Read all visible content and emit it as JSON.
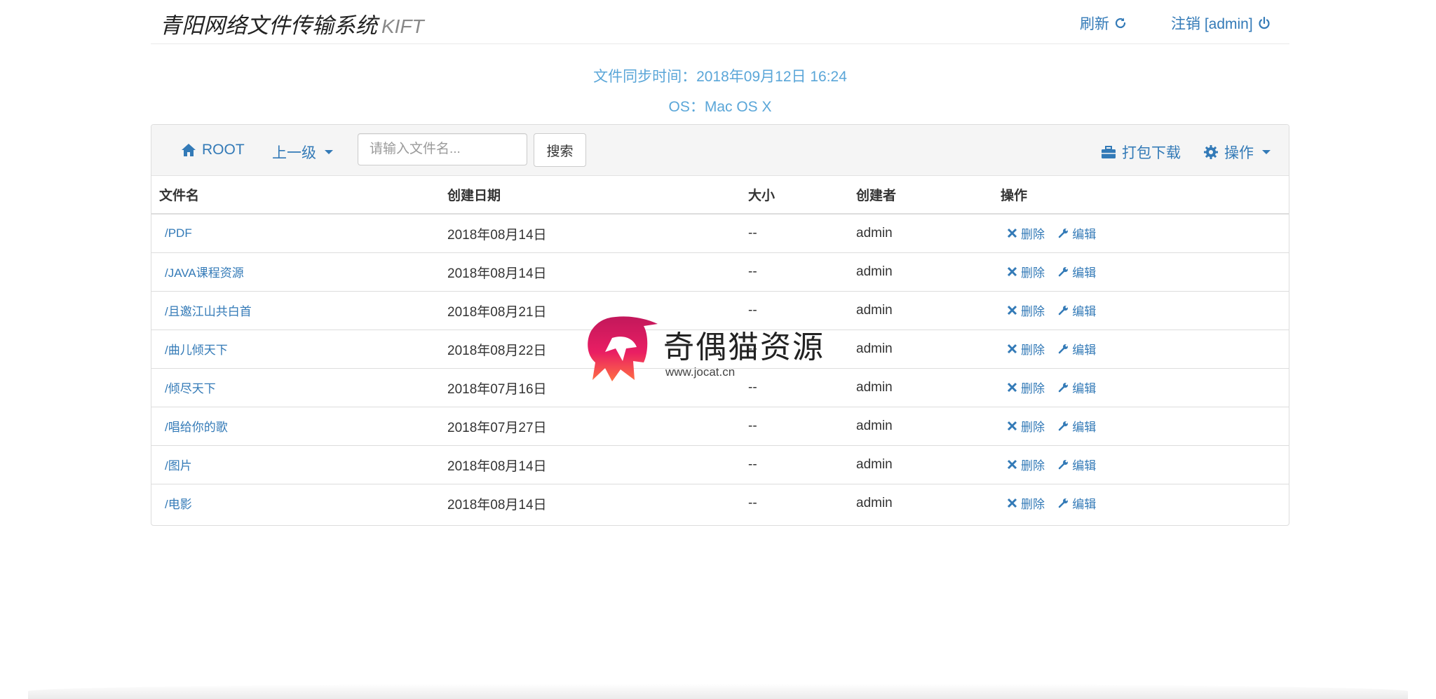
{
  "header": {
    "title": "青阳网络文件传输系统",
    "subtitle": "KIFT",
    "refresh_label": "刷新",
    "logout_label": "注销 [admin]"
  },
  "info": {
    "sync_time": "文件同步时间：2018年09月12日 16:24",
    "os": "OS：Mac OS X"
  },
  "toolbar": {
    "root_label": "ROOT",
    "parent_label": "上一级",
    "search_placeholder": "请输入文件名...",
    "search_button": "搜索",
    "pack_download_label": "打包下载",
    "operations_label": "操作"
  },
  "table": {
    "headers": [
      "文件名",
      "创建日期",
      "大小",
      "创建者",
      "操作"
    ],
    "delete_label": "删除",
    "edit_label": "编辑",
    "rows": [
      {
        "name": "/PDF",
        "date": "2018年08月14日",
        "size": "--",
        "creator": "admin"
      },
      {
        "name": "/JAVA课程资源",
        "date": "2018年08月14日",
        "size": "--",
        "creator": "admin"
      },
      {
        "name": "/且邀江山共白首",
        "date": "2018年08月21日",
        "size": "--",
        "creator": "admin"
      },
      {
        "name": "/曲儿倾天下",
        "date": "2018年08月22日",
        "size": "--",
        "creator": "admin"
      },
      {
        "name": "/倾尽天下",
        "date": "2018年07月16日",
        "size": "--",
        "creator": "admin"
      },
      {
        "name": "/唱给你的歌",
        "date": "2018年07月27日",
        "size": "--",
        "creator": "admin"
      },
      {
        "name": "/图片",
        "date": "2018年08月14日",
        "size": "--",
        "creator": "admin"
      },
      {
        "name": "/电影",
        "date": "2018年08月14日",
        "size": "--",
        "creator": "admin"
      }
    ]
  },
  "watermark": {
    "text": "奇偶猫资源",
    "url": "www.jocat.cn"
  },
  "colors": {
    "link": "#337ab7",
    "info": "#5aa6d8",
    "toolbar_bg": "#f5f5f5"
  },
  "icons": {
    "refresh": "refresh-icon",
    "power": "power-icon",
    "home": "home-icon",
    "briefcase": "briefcase-icon",
    "gear": "gear-icon",
    "delete": "close-icon",
    "edit": "wrench-icon"
  }
}
